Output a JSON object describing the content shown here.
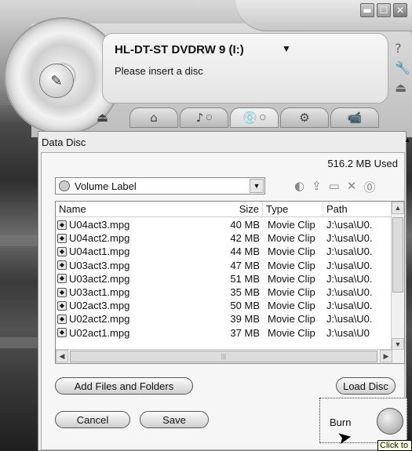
{
  "window": {
    "controls": [
      "▬",
      "☐",
      "✕"
    ]
  },
  "player": {
    "drive_name": "HL-DT-ST DVDRW 9 (I:)",
    "drive_arrow": "▼",
    "status": "Please insert a disc",
    "side_icons": [
      "?",
      "🔧",
      "⏏"
    ],
    "tabs": [
      {
        "icon": "⌂",
        "name": "home"
      },
      {
        "icon": "♪",
        "name": "music"
      },
      {
        "icon": "💿",
        "name": "disc"
      },
      {
        "icon": "⚙",
        "name": "tools"
      },
      {
        "icon": "📹",
        "name": "video"
      }
    ]
  },
  "main": {
    "title": "Data Disc",
    "used": "516.2 MB Used",
    "volume_label": "Volume Label",
    "columns": {
      "name": "Name",
      "size": "Size",
      "type": "Type",
      "path": "Path"
    },
    "files": [
      {
        "name": "U04act3.mpg",
        "size": "40 MB",
        "type": "Movie Clip",
        "path": "J:\\usa\\U0."
      },
      {
        "name": "U04act2.mpg",
        "size": "42 MB",
        "type": "Movie Clip",
        "path": "J:\\usa\\U0."
      },
      {
        "name": "U04act1.mpg",
        "size": "44 MB",
        "type": "Movie Clip",
        "path": "J:\\usa\\U0."
      },
      {
        "name": "U03act3.mpg",
        "size": "47 MB",
        "type": "Movie Clip",
        "path": "J:\\usa\\U0."
      },
      {
        "name": "U03act2.mpg",
        "size": "51 MB",
        "type": "Movie Clip",
        "path": "J:\\usa\\U0."
      },
      {
        "name": "U03act1.mpg",
        "size": "35 MB",
        "type": "Movie Clip",
        "path": "J:\\usa\\U0."
      },
      {
        "name": "U02act3.mpg",
        "size": "50 MB",
        "type": "Movie Clip",
        "path": "J:\\usa\\U0."
      },
      {
        "name": "U02act2.mpg",
        "size": "39 MB",
        "type": "Movie Clip",
        "path": "J:\\usa\\U0."
      },
      {
        "name": "U02act1.mpg",
        "size": "37 MB",
        "type": "Movie Clip",
        "path": "J:\\usa\\U0"
      }
    ],
    "add_files": "Add Files and Folders",
    "load_disc": "Load Disc",
    "cancel": "Cancel",
    "save": "Save",
    "burn": "Burn",
    "tooltip": "Click to"
  }
}
